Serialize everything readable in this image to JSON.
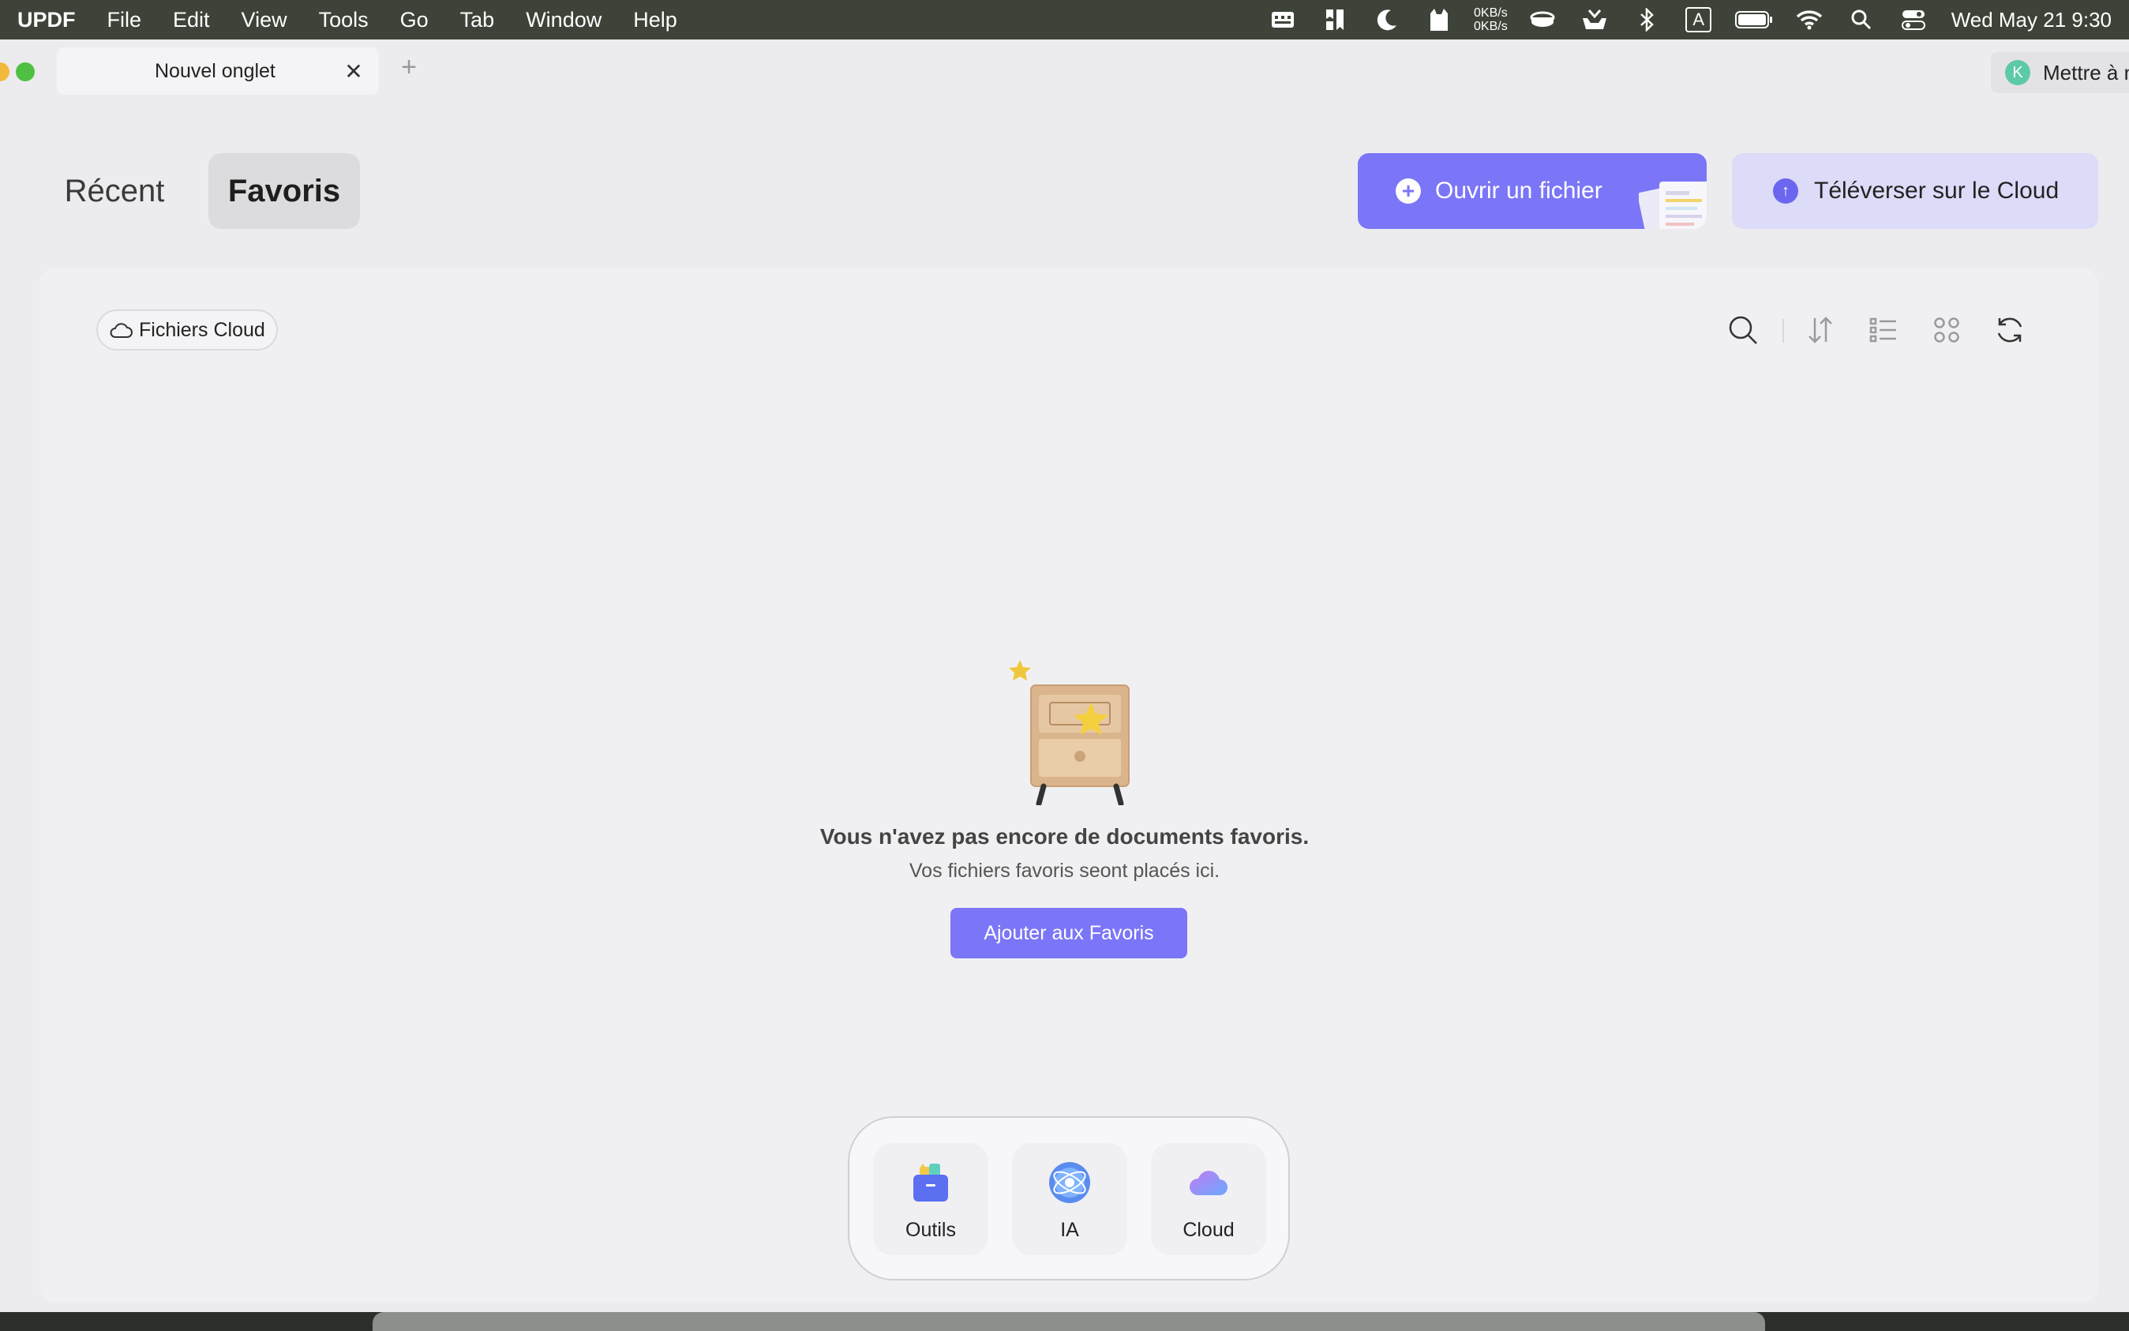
{
  "menubar": {
    "app_name": "UPDF",
    "menus": [
      "File",
      "Edit",
      "View",
      "Tools",
      "Go",
      "Tab",
      "Window",
      "Help"
    ],
    "net_up": "0KB/s",
    "net_down": "0KB/s",
    "keyboard_input": "A",
    "clock": "Wed May 21  9:30",
    "icons": [
      "menu-extra-icon",
      "bookmark-icon",
      "moon-icon",
      "cat-icon",
      "disk-icon",
      "inbox-icon",
      "bluetooth-icon",
      "battery-icon",
      "wifi-icon",
      "spotlight-icon",
      "control-center-icon"
    ]
  },
  "tabs": {
    "active_title": "Nouvel onglet",
    "close_symbol": "✕",
    "new_tab_symbol": "+",
    "upgrade_label": "Mettre à n",
    "upgrade_avatar": "K"
  },
  "header": {
    "segments": [
      "Récent",
      "Favoris"
    ],
    "selected_segment": "Favoris",
    "open_file_label": "Ouvrir un fichier",
    "upload_cloud_label": "Téléverser sur le Cloud"
  },
  "filter": {
    "cloud_files_label": "Fichiers Cloud"
  },
  "empty_state": {
    "title": "Vous n'avez pas encore de documents favoris.",
    "subtitle": "Vos fichiers favoris seont placés ici.",
    "action_label": "Ajouter aux Favoris"
  },
  "quick_dock": {
    "items": [
      "Outils",
      "IA",
      "Cloud"
    ]
  },
  "colors": {
    "accent": "#7b76f7",
    "accent_light": "#dcdbf8",
    "menubar_bg": "#3d4338"
  }
}
